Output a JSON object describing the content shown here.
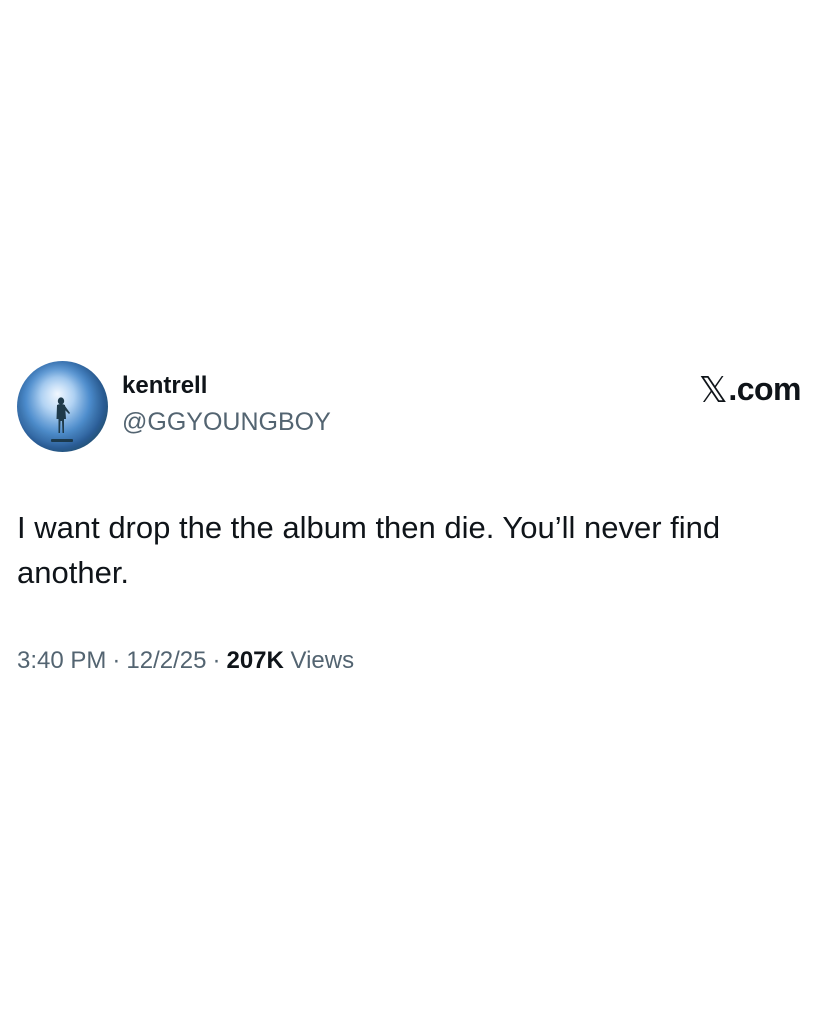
{
  "tweet": {
    "author": {
      "display_name": "kentrell",
      "handle": "@GGYOUNGBOY",
      "avatar_icon": "silhouette-performer-on-stage"
    },
    "brand": {
      "glyph": "𝕏",
      "text": ".com"
    },
    "text": "I want drop the the album then die. You’ll never find another.",
    "meta": {
      "time": "3:40 PM",
      "date": "12/2/25",
      "separator": "·",
      "views_count": "207K",
      "views_label": "Views"
    }
  },
  "colors": {
    "primary_text": "#0f1419",
    "secondary_text": "#536471",
    "background": "#ffffff"
  }
}
